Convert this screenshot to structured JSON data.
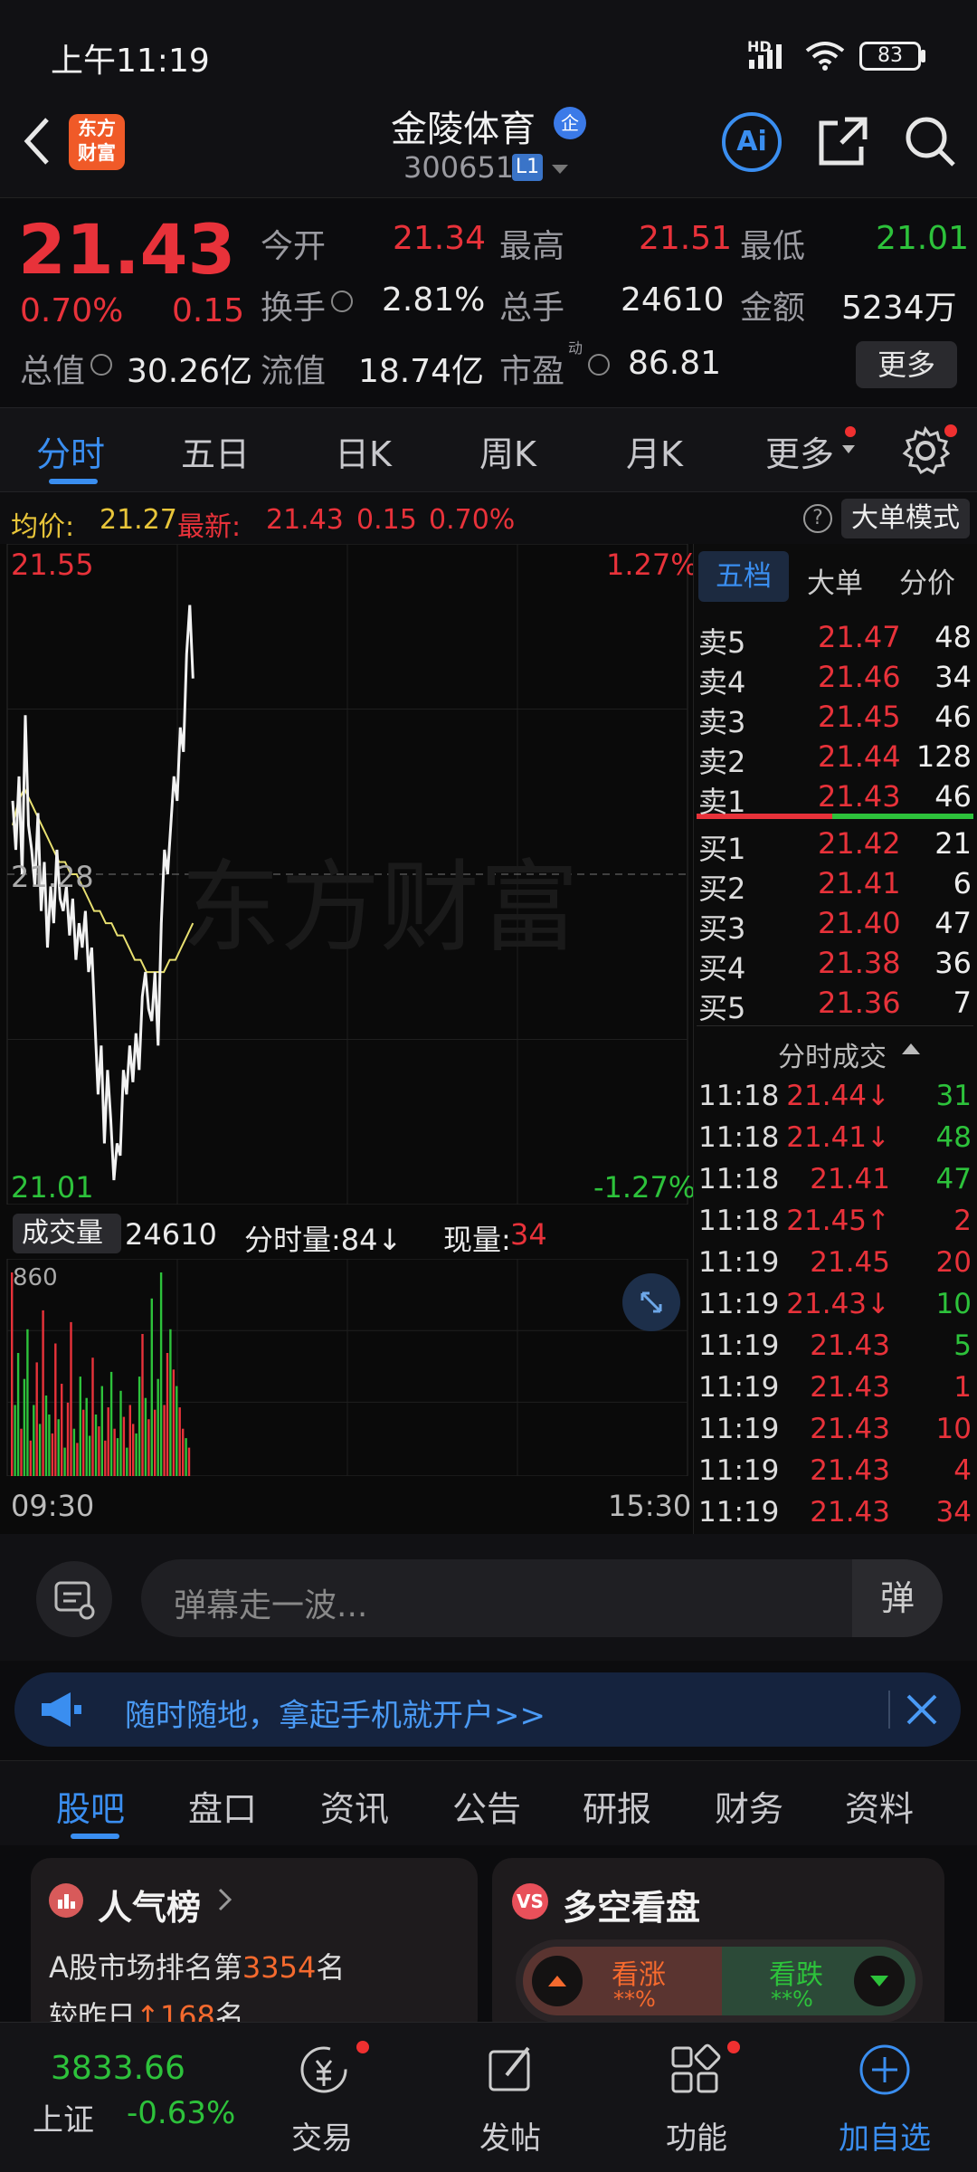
{
  "status": {
    "time": "上午11:19",
    "network": "HD",
    "battery": "83"
  },
  "nav": {
    "logo_line1": "东方",
    "logo_line2": "财富",
    "stock_name": "金陵体育",
    "badge": "企",
    "stock_code": "300651",
    "level": "L1"
  },
  "quote": {
    "price": "21.43",
    "change_pct": "0.70%",
    "change_amt": "0.15",
    "open_label": "今开",
    "open": "21.34",
    "high_label": "最高",
    "high": "21.51",
    "low_label": "最低",
    "low": "21.01",
    "turnover_label": "换手",
    "turnover": "2.81%",
    "volume_label": "总手",
    "volume": "24610",
    "amount_label": "金额",
    "amount": "5234万",
    "mktcap_label": "总值",
    "mktcap": "30.26亿",
    "float_label": "流值",
    "float": "18.74亿",
    "pe_label": "市盈",
    "pe_sup": "动",
    "pe": "86.81",
    "more_button": "更多"
  },
  "tabs": [
    "分时",
    "五日",
    "日K",
    "周K",
    "月K",
    "更多"
  ],
  "info_bar": {
    "avg_label": "均价:",
    "avg": "21.27",
    "latest_label": "最新:",
    "latest": "21.43",
    "chg": "0.15",
    "pct": "0.70%",
    "help": "?",
    "mode_button": "大单模式"
  },
  "chart_data": {
    "type": "line",
    "y_labels": {
      "top": "21.55",
      "mid": "21.28",
      "bottom": "21.01",
      "top_pct": "1.27%",
      "bottom_pct": "-1.27%"
    },
    "ylim": [
      21.01,
      21.55
    ],
    "prev_close": 21.28,
    "price_series": [
      21.34,
      21.3,
      21.36,
      21.28,
      21.41,
      21.32,
      21.3,
      21.27,
      21.33,
      21.25,
      21.29,
      21.22,
      21.27,
      21.24,
      21.3,
      21.26,
      21.25,
      21.27,
      21.23,
      21.26,
      21.21,
      21.24,
      21.22,
      21.25,
      21.2,
      21.22,
      21.16,
      21.1,
      21.14,
      21.06,
      21.12,
      21.08,
      21.03,
      21.06,
      21.05,
      21.12,
      21.1,
      21.14,
      21.11,
      21.15,
      21.12,
      21.18,
      21.2,
      21.17,
      21.16,
      21.2,
      21.14,
      21.24,
      21.3,
      21.28,
      21.32,
      21.36,
      21.34,
      21.4,
      21.38,
      21.46,
      21.5,
      21.44
    ],
    "avg_series": [
      21.32,
      21.34,
      21.35,
      21.34,
      21.33,
      21.32,
      21.31,
      21.3,
      21.29,
      21.29,
      21.28,
      21.28,
      21.27,
      21.26,
      21.25,
      21.25,
      21.24,
      21.24,
      21.23,
      21.23,
      21.22,
      21.21,
      21.21,
      21.2,
      21.2,
      21.2,
      21.2,
      21.21,
      21.21,
      21.22,
      21.23,
      21.24
    ],
    "x_labels": [
      "09:30",
      "15:30"
    ],
    "volume": {
      "label": "成交量",
      "total": "24610",
      "tick_label": "分时量:84↓",
      "now_label": "现量:",
      "now": "34",
      "y_max": "860",
      "bars": [
        860,
        300,
        520,
        200,
        410,
        620,
        150,
        300,
        480,
        220,
        700,
        340,
        260,
        180,
        560,
        240,
        390,
        120,
        310,
        650,
        200,
        140,
        420,
        280,
        330,
        170,
        500,
        260,
        210,
        380,
        150,
        290,
        440,
        200,
        160,
        360,
        250,
        120,
        300,
        220,
        180,
        420,
        600,
        330,
        240,
        750,
        280,
        410,
        860,
        300,
        520,
        620,
        450,
        380,
        290,
        200,
        160,
        120
      ],
      "colors": [
        "r",
        "g",
        "g",
        "r",
        "g",
        "g",
        "r",
        "g",
        "r",
        "g",
        "r",
        "g",
        "g",
        "r",
        "r",
        "g",
        "r",
        "g",
        "r",
        "r",
        "g",
        "r",
        "g",
        "r",
        "g",
        "g",
        "r",
        "g",
        "r",
        "g",
        "r",
        "r",
        "g",
        "r",
        "g",
        "g",
        "r",
        "g",
        "r",
        "r",
        "g",
        "g",
        "r",
        "g",
        "r",
        "g",
        "r",
        "g",
        "g",
        "r",
        "r",
        "g",
        "r",
        "g",
        "r",
        "r",
        "g",
        "r"
      ]
    }
  },
  "orderbook": {
    "tabs": [
      "五档",
      "大单",
      "分价"
    ],
    "asks": [
      {
        "label": "卖5",
        "price": "21.47",
        "vol": "48"
      },
      {
        "label": "卖4",
        "price": "21.46",
        "vol": "34"
      },
      {
        "label": "卖3",
        "price": "21.45",
        "vol": "46"
      },
      {
        "label": "卖2",
        "price": "21.44",
        "vol": "128"
      },
      {
        "label": "卖1",
        "price": "21.43",
        "vol": "46"
      }
    ],
    "bids": [
      {
        "label": "买1",
        "price": "21.42",
        "vol": "21"
      },
      {
        "label": "买2",
        "price": "21.41",
        "vol": "6"
      },
      {
        "label": "买3",
        "price": "21.40",
        "vol": "47"
      },
      {
        "label": "买4",
        "price": "21.38",
        "vol": "36"
      },
      {
        "label": "买5",
        "price": "21.36",
        "vol": "7"
      }
    ],
    "ticks_title": "分时成交",
    "ticks": [
      {
        "t": "11:18",
        "p": "21.44↓",
        "v": "31",
        "vc": "g"
      },
      {
        "t": "11:18",
        "p": "21.41↓",
        "v": "48",
        "vc": "g"
      },
      {
        "t": "11:18",
        "p": "21.41",
        "v": "47",
        "vc": "g"
      },
      {
        "t": "11:18",
        "p": "21.45↑",
        "v": "2",
        "vc": "r"
      },
      {
        "t": "11:19",
        "p": "21.45",
        "v": "20",
        "vc": "r"
      },
      {
        "t": "11:19",
        "p": "21.43↓",
        "v": "10",
        "vc": "g"
      },
      {
        "t": "11:19",
        "p": "21.43",
        "v": "5",
        "vc": "g"
      },
      {
        "t": "11:19",
        "p": "21.43",
        "v": "1",
        "vc": "r"
      },
      {
        "t": "11:19",
        "p": "21.43",
        "v": "10",
        "vc": "r"
      },
      {
        "t": "11:19",
        "p": "21.43",
        "v": "4",
        "vc": "r"
      },
      {
        "t": "11:19",
        "p": "21.43",
        "v": "34",
        "vc": "r"
      }
    ]
  },
  "chat": {
    "placeholder": "弹幕走一波...",
    "danmu": "弹"
  },
  "banner": {
    "text": "随时随地，拿起手机就开户>>"
  },
  "subtabs": [
    "股吧",
    "盘口",
    "资讯",
    "公告",
    "研报",
    "财务",
    "资料"
  ],
  "cards": {
    "pop_title": "人气榜",
    "pop_line1a": "A股市场排名第",
    "pop_rank": "3354",
    "pop_line1b": "名",
    "pop_line2a": "较昨日",
    "pop_change": "168",
    "pop_line2b": "名",
    "ls_title": "多空看盘",
    "bull": "看涨",
    "bull_pct": "**%",
    "bear": "看跌",
    "bear_pct": "**%"
  },
  "bottom": {
    "index_value": "3833.66",
    "index_name": "上证",
    "index_pct": "-0.63%",
    "trade": "交易",
    "post": "发帖",
    "func": "功能",
    "add": "加自选"
  }
}
